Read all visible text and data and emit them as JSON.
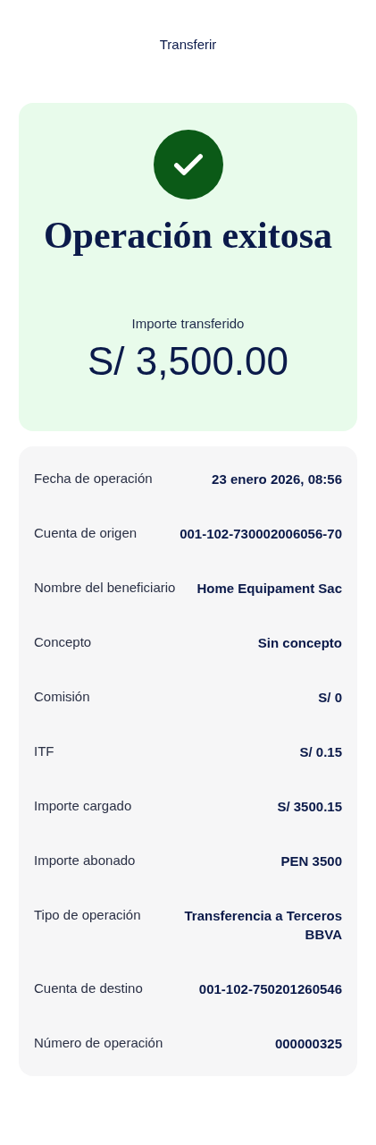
{
  "header": {
    "title": "Transferir"
  },
  "result": {
    "success": true,
    "title": "Operación exitosa",
    "amount_label": "Importe transferido",
    "amount": "S/ 3,500.00"
  },
  "details": [
    {
      "label": "Fecha de operación",
      "value": "23 enero 2026, 08:56"
    },
    {
      "label": "Cuenta de origen",
      "value": "001-102-730002006056-70"
    },
    {
      "label": "Nombre del beneficiario",
      "value": "Home Equipament Sac"
    },
    {
      "label": "Concepto",
      "value": "Sin concepto"
    },
    {
      "label": "Comisión",
      "value": "S/ 0"
    },
    {
      "label": "ITF",
      "value": "S/ 0.15"
    },
    {
      "label": "Importe cargado",
      "value": "S/ 3500.15"
    },
    {
      "label": "Importe abonado",
      "value": "PEN 3500"
    },
    {
      "label": "Tipo de operación",
      "value": "Transferencia a Terceros BBVA"
    },
    {
      "label": "Cuenta de destino",
      "value": "001-102-750201260546"
    },
    {
      "label": "Número de operación",
      "value": "000000325"
    }
  ]
}
